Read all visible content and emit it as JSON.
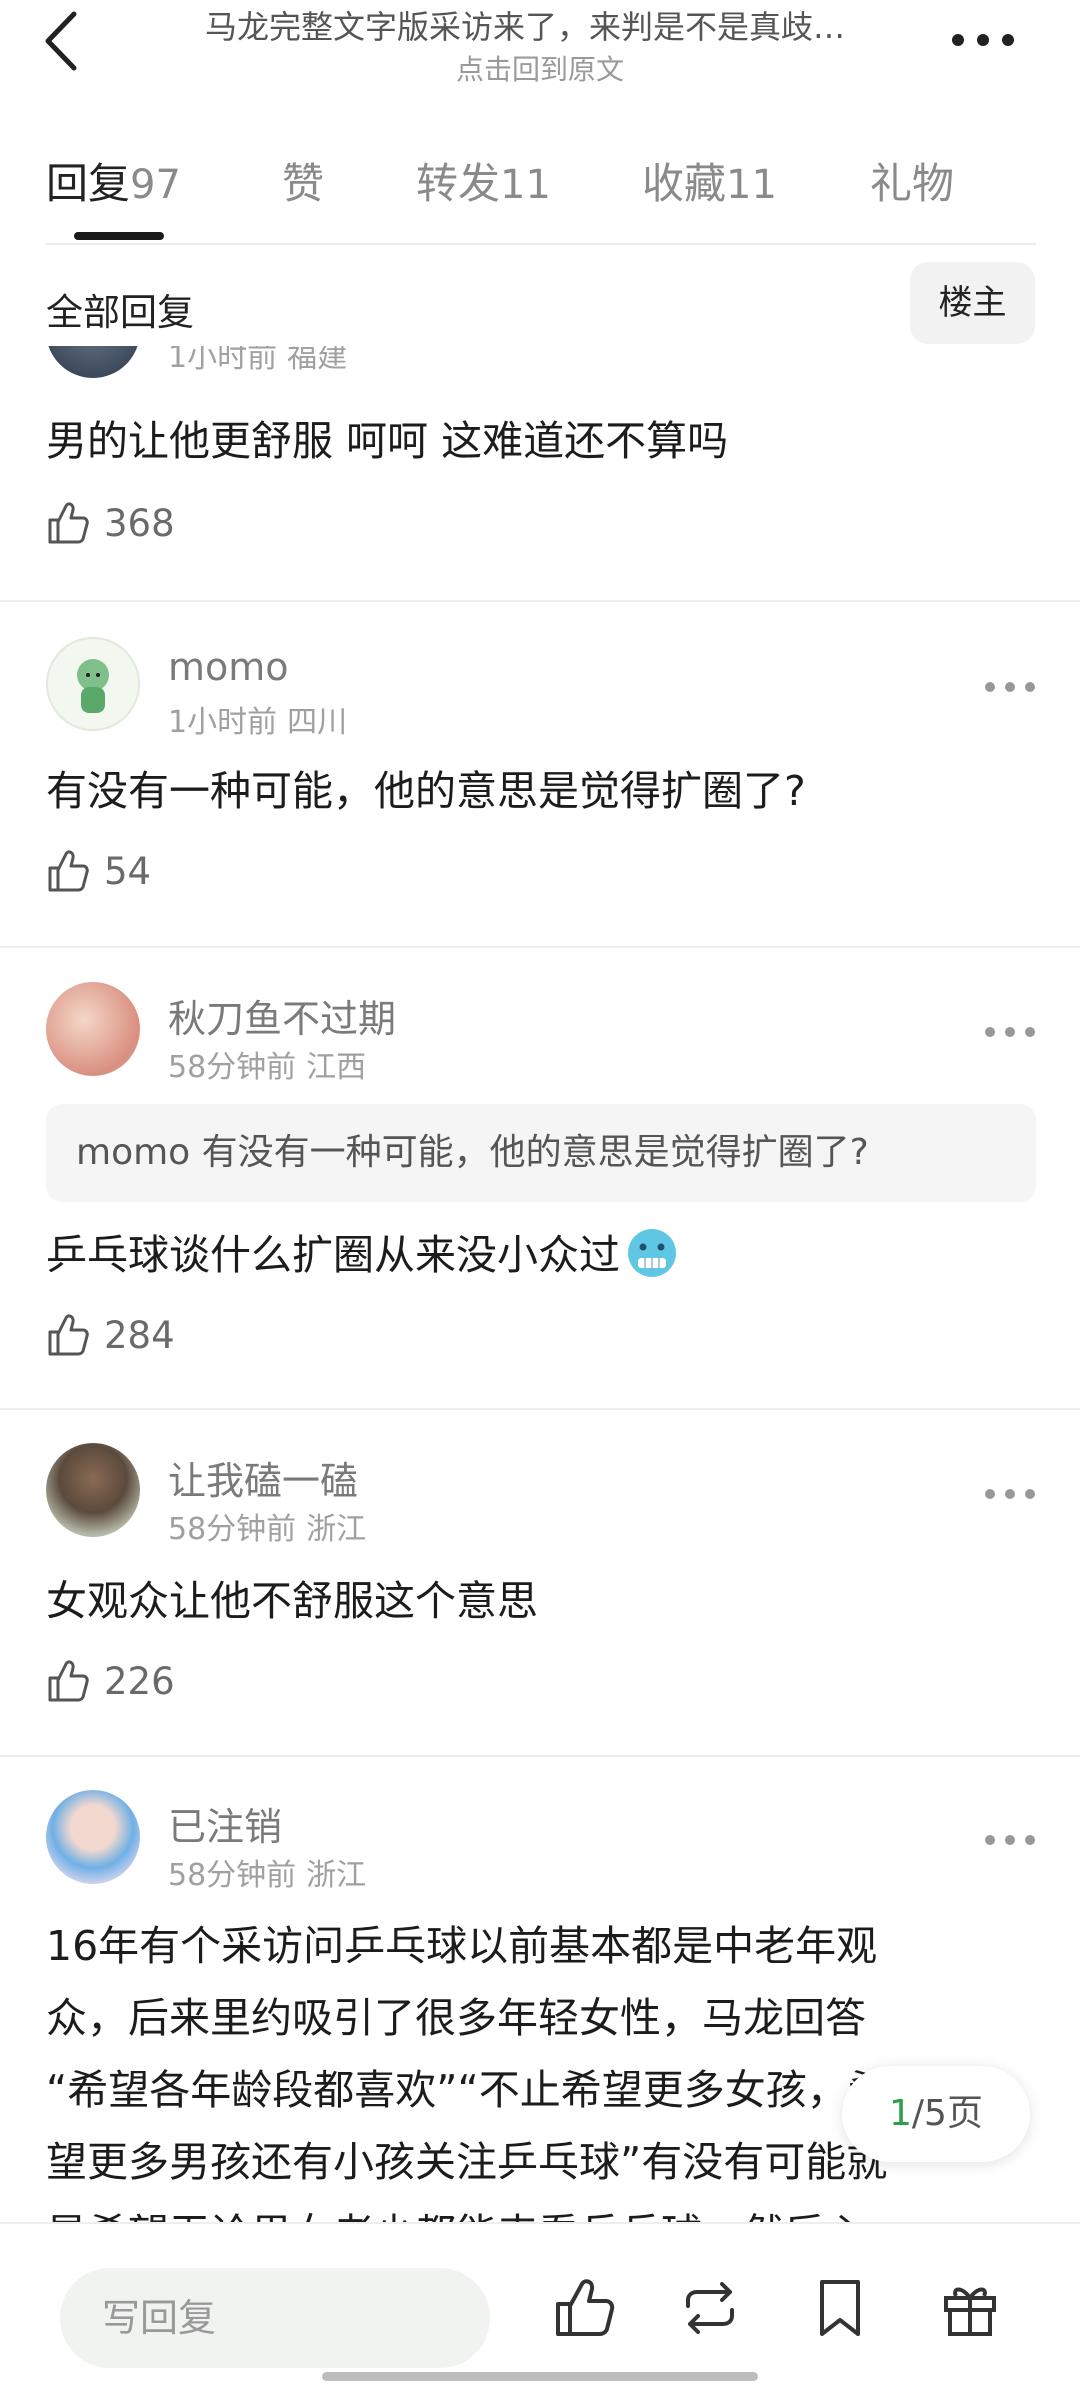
{
  "header": {
    "title": "马龙完整文字版采访来了，来判是不是真歧…",
    "subtitle": "点击回到原文"
  },
  "tabs": [
    {
      "label": "回复",
      "count": "97"
    },
    {
      "label": "赞",
      "count": ""
    },
    {
      "label": "转发",
      "count": "11"
    },
    {
      "label": "收藏",
      "count": "11"
    },
    {
      "label": "礼物",
      "count": ""
    }
  ],
  "filter": {
    "label": "全部回复",
    "owner_button": "楼主"
  },
  "partial_meta": {
    "time": "1小时前",
    "location": "福建"
  },
  "comments": [
    {
      "text": "男的让他更舒服 呵呵 这难道还不算吗",
      "likes": "368"
    },
    {
      "username": "momo",
      "time": "1小时前",
      "location": "四川",
      "text": "有没有一种可能，他的意思是觉得扩圈了?",
      "likes": "54"
    },
    {
      "username": "秋刀鱼不过期",
      "time": "58分钟前",
      "location": "江西",
      "quote": "momo 有没有一种可能，他的意思是觉得扩圈了?",
      "text": "乒乓球谈什么扩圈从来没小众过",
      "emoji": "freezing-face-emoji",
      "likes": "284"
    },
    {
      "username": "让我磕一磕",
      "time": "58分钟前",
      "location": "浙江",
      "text": "女观众让他不舒服这个意思",
      "likes": "226"
    },
    {
      "username": "已注销",
      "time": "58分钟前",
      "location": "浙江",
      "lines": [
        "16年有个采访问乒乓球以前基本都是中老年观",
        "众，后来里约吸引了很多年轻女性，马龙回答",
        "“希望各年龄段都喜欢”“不止希望更多女孩，希",
        "望更多男孩还有小孩关注乒乓球”有没有可能就",
        "是希望无论男女老少都能来看乒乓球，然后心"
      ]
    }
  ],
  "pagination": {
    "current": "1",
    "total": "/5页"
  },
  "bottom_bar": {
    "reply_placeholder": "写回复",
    "icons": [
      "like-icon",
      "repost-icon",
      "bookmark-icon",
      "gift-icon"
    ]
  },
  "colors": {
    "accent_green": "#2aa146",
    "text": "#1a1a1a",
    "muted": "#a0a0a0"
  }
}
